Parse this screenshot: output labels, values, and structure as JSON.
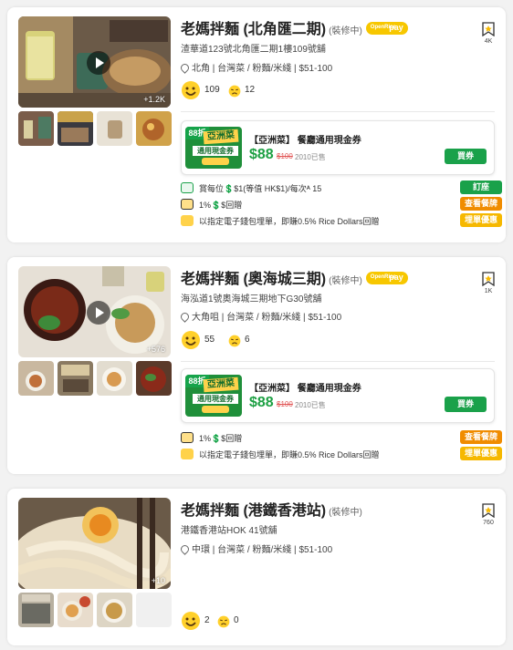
{
  "colors": {
    "brand_green": "#1aa14a",
    "price_green": "#1da043",
    "orange": "#f08c00",
    "yellow": "#f6b800",
    "openrice_pay": "#f7c700",
    "strike_red": "#e05252"
  },
  "openrice_pay_badge": {
    "top": "OpenRice",
    "bottom": "pay"
  },
  "restaurants": [
    {
      "name": "老媽拌麵 (北角匯二期)",
      "status": "(裝修中)",
      "address": "渣華道123號北角匯二期1樓109號舖",
      "district": "北角",
      "cuisine": "台灣菜 / 粉麵/米綫",
      "price_range": "$51-100",
      "photo_count": "+1.2K",
      "smile_count": "109",
      "cry_count": "12",
      "bookmark_count": "4K",
      "voucher": {
        "discount": "88折",
        "title": "【亞洲菜】 餐廳通用現金券",
        "price": "$88",
        "original_price": "$100",
        "sold": "2010已售",
        "buy_label": "買券",
        "image_text_1": "亞洲菜",
        "image_text_2": "通用現金券"
      },
      "promos": [
        {
          "icon": "cash-icon",
          "text": "賞每位💲$1(等值 HK$1)/每次ᴬ 15",
          "button": "訂座",
          "button_color": "green"
        },
        {
          "icon": "coin-icon",
          "text": "1%💲$回贈",
          "button": "查看餐牌",
          "button_color": "orange"
        },
        {
          "icon": "pay-icon",
          "text": "以指定電子錢包埋單，即賺0.5% Rice Dollars回贈",
          "button": "埋單優惠",
          "button_color": "yellow"
        }
      ]
    },
    {
      "name": "老媽拌麵 (奧海城三期)",
      "status": "(裝修中)",
      "address": "海泓道1號奧海城三期地下G30號舖",
      "district": "大角咀",
      "cuisine": "台灣菜 / 粉麵/米綫",
      "price_range": "$51-100",
      "photo_count": "+576",
      "smile_count": "55",
      "cry_count": "6",
      "bookmark_count": "1K",
      "voucher": {
        "discount": "88折",
        "title": "【亞洲菜】 餐廳通用現金券",
        "price": "$88",
        "original_price": "$100",
        "sold": "2010已售",
        "buy_label": "買券",
        "image_text_1": "亞洲菜",
        "image_text_2": "通用現金券"
      },
      "promos": [
        {
          "icon": "coin-icon",
          "text": "1%💲$回贈",
          "button": "查看餐牌",
          "button_color": "orange"
        },
        {
          "icon": "pay-icon",
          "text": "以指定電子錢包埋單，即賺0.5% Rice Dollars回贈",
          "button": "埋單優惠",
          "button_color": "yellow"
        }
      ]
    },
    {
      "name": "老媽拌麵 (港鐵香港站)",
      "status": "(裝修中)",
      "address": "港鐵香港站HOK 41號舖",
      "district": "中環",
      "cuisine": "台灣菜 / 粉麵/米綫",
      "price_range": "$51-100",
      "photo_count": "+10",
      "smile_count": "2",
      "cry_count": "0",
      "bookmark_count": "760"
    }
  ]
}
